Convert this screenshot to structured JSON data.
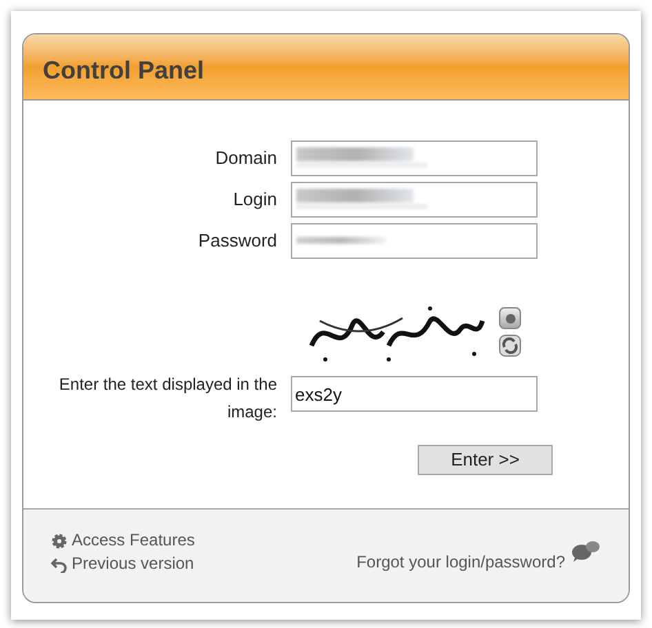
{
  "panel": {
    "title": "Control Panel"
  },
  "fields": [
    {
      "label": "Domain",
      "kind": "blurred"
    },
    {
      "label": "Login",
      "kind": "blurred"
    },
    {
      "label": "Password",
      "kind": "blurred_short"
    }
  ],
  "captcha": {
    "kind": "picture",
    "prompt": "Enter the text displayed in the image:",
    "value": "exs2y"
  },
  "submit": "Enter >>",
  "footer": {
    "links": [
      {
        "label": "Access Features",
        "kind": "gear"
      },
      {
        "label": "Previous version",
        "kind": "undo"
      }
    ],
    "help": "Forgot your login/password?"
  }
}
